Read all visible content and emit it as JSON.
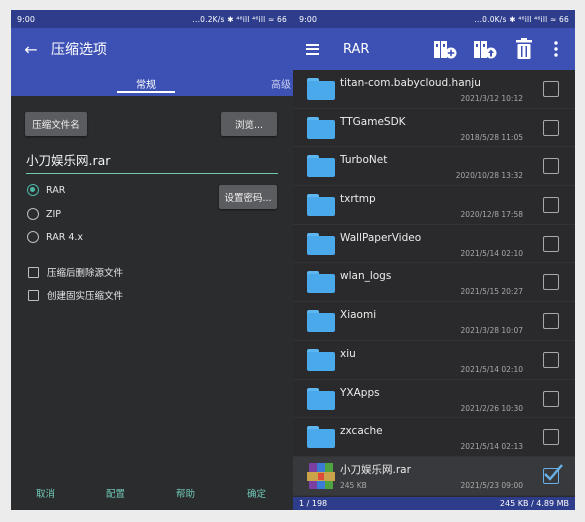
{
  "left_status": {
    "time": "9:00",
    "info": "...0.2K/s ✱ ⁴⁶ill ⁴⁶ill ≈ 66"
  },
  "right_status": {
    "time": "9:00",
    "info": "...0.0K/s ✱ ⁴⁶ill ⁴⁶ill ≈ 66"
  },
  "dialog": {
    "title": "压缩选项",
    "tabs": [
      "常规",
      "高级"
    ],
    "archive_name_button": "压缩文件名",
    "browse_button": "浏览...",
    "filename": "小刀娱乐网.rar",
    "formats": [
      {
        "label": "RAR",
        "selected": true
      },
      {
        "label": "ZIP",
        "selected": false
      },
      {
        "label": "RAR 4.x",
        "selected": false
      }
    ],
    "password_button": "设置密码...",
    "options": [
      {
        "label": "压缩后删除源文件",
        "checked": false
      },
      {
        "label": "创建固实压缩文件",
        "checked": false
      }
    ],
    "footer": [
      "取消",
      "配置",
      "帮助",
      "确定"
    ]
  },
  "browser": {
    "title": "RAR",
    "toolbar_icons": [
      "add-archive-icon",
      "extract-icon",
      "delete-icon",
      "more-vert-icon"
    ],
    "files": [
      {
        "name": "titan-com.babycloud.hanju",
        "date": "2021/3/12 10:12",
        "type": "folder",
        "checked": false
      },
      {
        "name": "TTGameSDK",
        "date": "2018/5/28 11:05",
        "type": "folder",
        "checked": false
      },
      {
        "name": "TurboNet",
        "date": "2020/10/28 13:32",
        "type": "folder",
        "checked": false
      },
      {
        "name": "txrtmp",
        "date": "2020/12/8 17:58",
        "type": "folder",
        "checked": false
      },
      {
        "name": "WallPaperVideo",
        "date": "2021/5/14 02:10",
        "type": "folder",
        "checked": false
      },
      {
        "name": "wlan_logs",
        "date": "2021/5/15 20:27",
        "type": "folder",
        "checked": false
      },
      {
        "name": "Xiaomi",
        "date": "2021/3/28 10:07",
        "type": "folder",
        "checked": false
      },
      {
        "name": "xiu",
        "date": "2021/5/14 02:10",
        "type": "folder",
        "checked": false
      },
      {
        "name": "YXApps",
        "date": "2021/2/26 10:30",
        "type": "folder",
        "checked": false
      },
      {
        "name": "zxcache",
        "date": "2021/5/14 02:13",
        "type": "folder",
        "checked": false
      },
      {
        "name": "小刀娱乐网.rar",
        "size": "245 KB",
        "date": "2021/5/23 09:00",
        "type": "rar",
        "checked": true
      }
    ],
    "bottom": {
      "count": "1 / 198",
      "size": "245 KB / 4.89 MB"
    }
  },
  "colors": {
    "primary": "#3d51b5",
    "status": "#2e3c8c",
    "accent": "#4eb7a5",
    "folder": "#4aa9ea"
  }
}
